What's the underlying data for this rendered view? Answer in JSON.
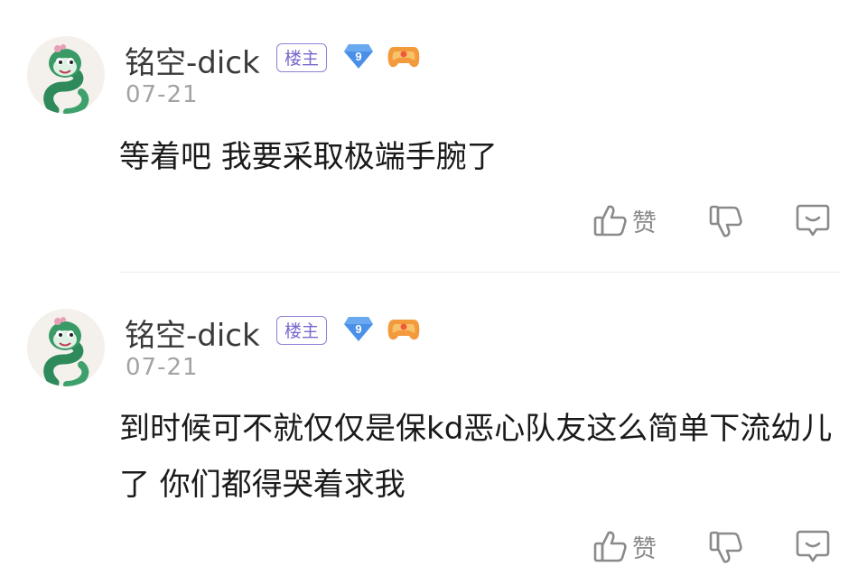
{
  "comments": [
    {
      "username": "铭空-dick",
      "host_badge": "楼主",
      "level": "9",
      "date": "07-21",
      "content": "等着吧 我要采取极端手腕了",
      "like_label": "赞"
    },
    {
      "username": "铭空-dick",
      "host_badge": "楼主",
      "level": "9",
      "date": "07-21",
      "content": "到时候可不就仅仅是保kd恶心队友这么简单下流幼儿了 你们都得哭着求我",
      "like_label": "赞"
    }
  ],
  "icons": {
    "avatar": "snake-avatar",
    "level": "blue-diamond-level-icon",
    "game": "game-controller-icon",
    "like": "thumbs-up-icon",
    "dislike": "thumbs-down-icon",
    "reply": "reply-chat-icon"
  },
  "colors": {
    "badge_purple": "#7a67cf",
    "level_blue": "#4a90e8",
    "game_orange": "#f39a3c",
    "text_primary": "#1a1a1a",
    "text_secondary": "#a3a3a3",
    "icon_gray": "#8a8a8a"
  }
}
